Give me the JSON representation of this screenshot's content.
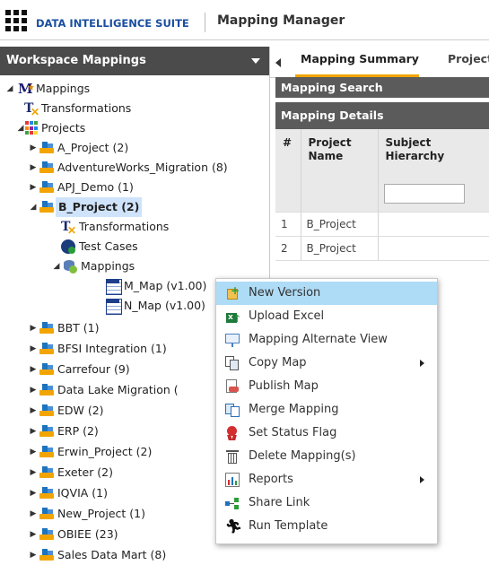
{
  "header": {
    "suite": "DATA INTELLIGENCE SUITE",
    "app": "Mapping Manager"
  },
  "left_panel": {
    "title": "Workspace Mappings"
  },
  "tree": {
    "root": "Mappings",
    "transformations": "Transformations",
    "projects": "Projects",
    "p_a": "A_Project (2)",
    "p_aw": "AdventureWorks_Migration (8)",
    "p_apj": "APJ_Demo (1)",
    "p_b": "B_Project (2)",
    "b_transformations": "Transformations",
    "b_testcases": "Test Cases",
    "b_mappings": "Mappings",
    "m_map": "M_Map (v1.00)",
    "n_map": "N_Map (v1.00)",
    "p_bbt": "BBT (1)",
    "p_bfsi": "BFSI Integration (1)",
    "p_carrefour": "Carrefour (9)",
    "p_datalake": "Data Lake Migration (",
    "p_edw": "EDW (2)",
    "p_erp": "ERP (2)",
    "p_erwin": "Erwin_Project (2)",
    "p_exeter": "Exeter (2)",
    "p_iqvia": "IQVIA (1)",
    "p_new": "New_Project (1)",
    "p_obiee": "OBIEE (23)",
    "p_sales": "Sales Data Mart (8)"
  },
  "tabs": {
    "summary": "Mapping Summary",
    "project": "Project"
  },
  "sections": {
    "search": "Mapping Search",
    "details": "Mapping Details"
  },
  "table": {
    "col_num": "#",
    "col_project": "Project Name",
    "col_subject": "Subject Hierarchy",
    "rows": [
      {
        "num": "1",
        "project": "B_Project"
      },
      {
        "num": "2",
        "project": "B_Project"
      }
    ]
  },
  "context_menu": {
    "new_version": "New Version",
    "upload_excel": "Upload Excel",
    "alternate_view": "Mapping Alternate View",
    "copy_map": "Copy Map",
    "publish_map": "Publish Map",
    "merge_mapping": "Merge Mapping",
    "status_flag": "Set Status Flag",
    "delete_mapping": "Delete Mapping(s)",
    "reports": "Reports",
    "share_link": "Share Link",
    "run_template": "Run Template"
  }
}
